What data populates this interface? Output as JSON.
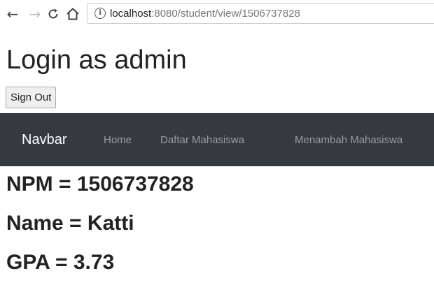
{
  "browser": {
    "url_host": "localhost",
    "url_path": ":8080/student/view/1506737828",
    "back_icon": "←",
    "forward_icon": "→",
    "reload_icon": "C",
    "home_icon": "⌂",
    "info_icon": "i"
  },
  "page": {
    "title": "Login as admin",
    "signout_label": "Sign Out"
  },
  "navbar": {
    "brand": "Navbar",
    "links": [
      "Home",
      "Daftar Mahasiswa",
      "Menambah Mahasiswa"
    ],
    "background": "#343a40"
  },
  "student": {
    "npm": "NPM = 1506737828",
    "name": "Name = Katti",
    "gpa": "GPA = 3.73"
  }
}
